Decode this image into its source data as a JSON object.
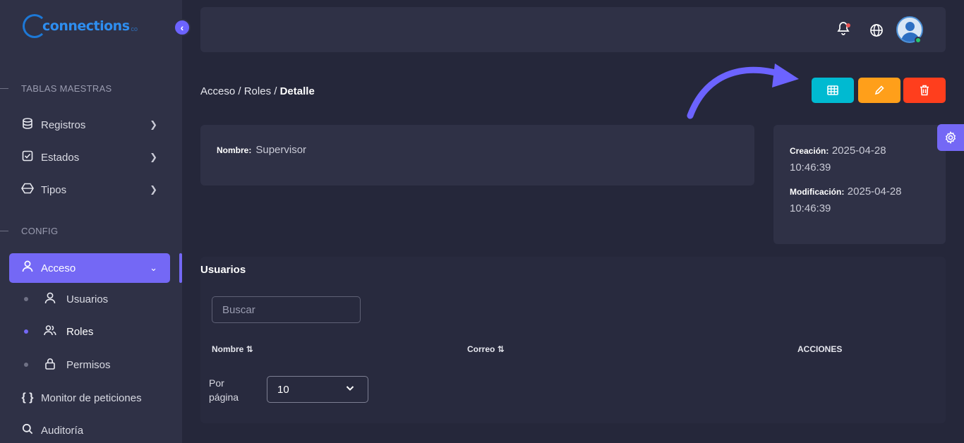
{
  "brand": {
    "name": "connections",
    "suffix": "co"
  },
  "sidebar": {
    "sections": [
      {
        "label": "TABLAS MAESTRAS"
      },
      {
        "label": "CONFIG"
      }
    ],
    "items": [
      {
        "label": "Registros",
        "icon": "database-icon"
      },
      {
        "label": "Estados",
        "icon": "checkbox-icon"
      },
      {
        "label": "Tipos",
        "icon": "shapes-icon"
      },
      {
        "label": "Acceso",
        "icon": "user-icon"
      }
    ],
    "subitems": [
      {
        "label": "Usuarios",
        "icon": "user-icon"
      },
      {
        "label": "Roles",
        "icon": "users-icon"
      },
      {
        "label": "Permisos",
        "icon": "lock-icon"
      }
    ],
    "bottom": [
      {
        "label": "Monitor de peticiones",
        "icon": "braces-icon"
      },
      {
        "label": "Auditoría",
        "icon": "search-icon"
      }
    ]
  },
  "breadcrumb": {
    "part1": "Acceso",
    "part2": "Roles",
    "current": "Detalle",
    "sep": "/"
  },
  "actions": {
    "colors": {
      "grid": "#00bad1",
      "edit": "#ff9f1a",
      "delete": "#ff3e1d"
    }
  },
  "detail": {
    "name_label": "Nombre:",
    "name_value": "Supervisor",
    "created_label": "Creación:",
    "created_value": "2025-04-28",
    "created_time": "10:46:39",
    "modified_label": "Modificación:",
    "modified_value": "2025-04-28",
    "modified_time": "10:46:39"
  },
  "users": {
    "title": "Usuarios",
    "search_placeholder": "Buscar",
    "columns": [
      "Nombre",
      "Correo",
      "ACCIONES"
    ],
    "per_page_label_1": "Por",
    "per_page_label_2": "página",
    "per_page_value": "10"
  },
  "accent": "#7468f5"
}
